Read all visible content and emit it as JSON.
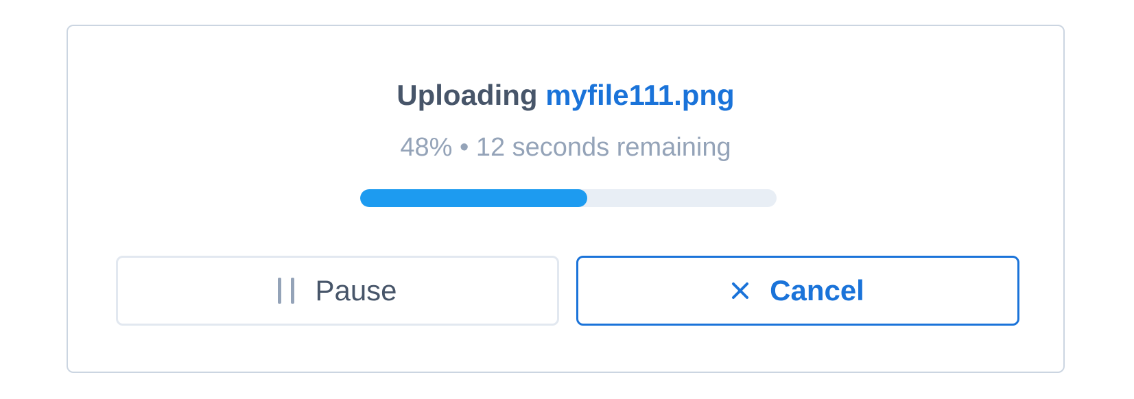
{
  "upload": {
    "title_prefix": "Uploading",
    "filename": "myfile111.png",
    "status_text": "48% • 12 seconds remaining",
    "progress_fraction": 0.545
  },
  "actions": {
    "pause_label": "Pause",
    "pause_icon": "pause-icon",
    "cancel_label": "Cancel",
    "cancel_icon": "close-icon"
  },
  "colors": {
    "accent": "#1a73d9",
    "progress": "#1d9bf0",
    "track": "#e8eef5",
    "text_primary": "#475569",
    "text_muted": "#94a3b8",
    "border": "#cbd5e1"
  }
}
